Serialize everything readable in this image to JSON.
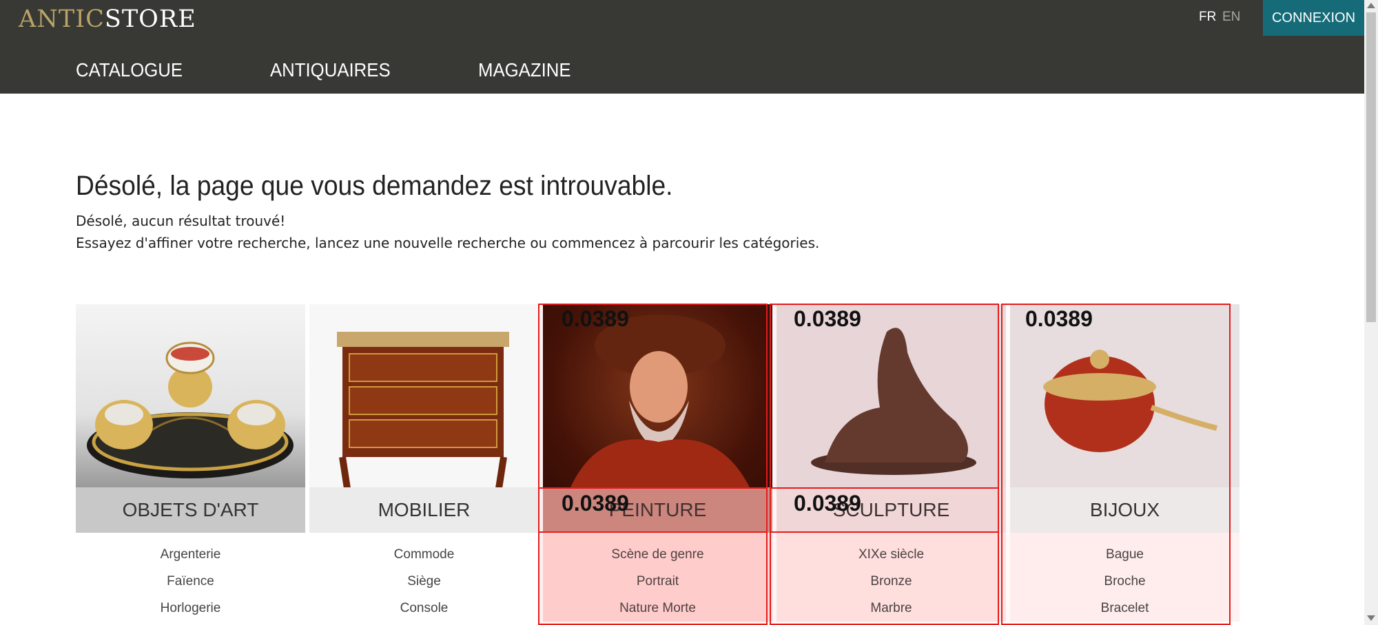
{
  "header": {
    "logo_part1": "ANTIC",
    "logo_part2": "STORE",
    "lang_fr": "FR",
    "lang_en": "EN",
    "login_label": "CONNEXION",
    "nav": [
      "CATALOGUE",
      "ANTIQUAIRES",
      "MAGAZINE"
    ]
  },
  "main": {
    "heading": "Désolé, la page que vous demandez est introuvable.",
    "message_1": "Désolé, aucun résultat trouvé!",
    "message_2": "Essayez d'affiner votre recherche, lancez une nouvelle recherche ou commencez à parcourir les catégories."
  },
  "categories": [
    {
      "name": "OBJETS D'ART",
      "subs": [
        "Argenterie",
        "Faïence",
        "Horlogerie"
      ]
    },
    {
      "name": "MOBILIER",
      "subs": [
        "Commode",
        "Siège",
        "Console"
      ]
    },
    {
      "name": "PEINTURE",
      "subs": [
        "Scène de genre",
        "Portrait",
        "Nature Morte"
      ]
    },
    {
      "name": "SCULPTURE",
      "subs": [
        "XIXe siècle",
        "Bronze",
        "Marbre"
      ]
    },
    {
      "name": "BIJOUX",
      "subs": [
        "Bague",
        "Broche",
        "Bracelet"
      ]
    }
  ],
  "overlay_scores": [
    "0.0389",
    "0.0389",
    "0.0389",
    "0.0389",
    "0.0389"
  ],
  "colors": {
    "topbar": "#383834",
    "accent": "#156c78",
    "gold": "#b9a467",
    "overlay": "#e41b1b"
  }
}
